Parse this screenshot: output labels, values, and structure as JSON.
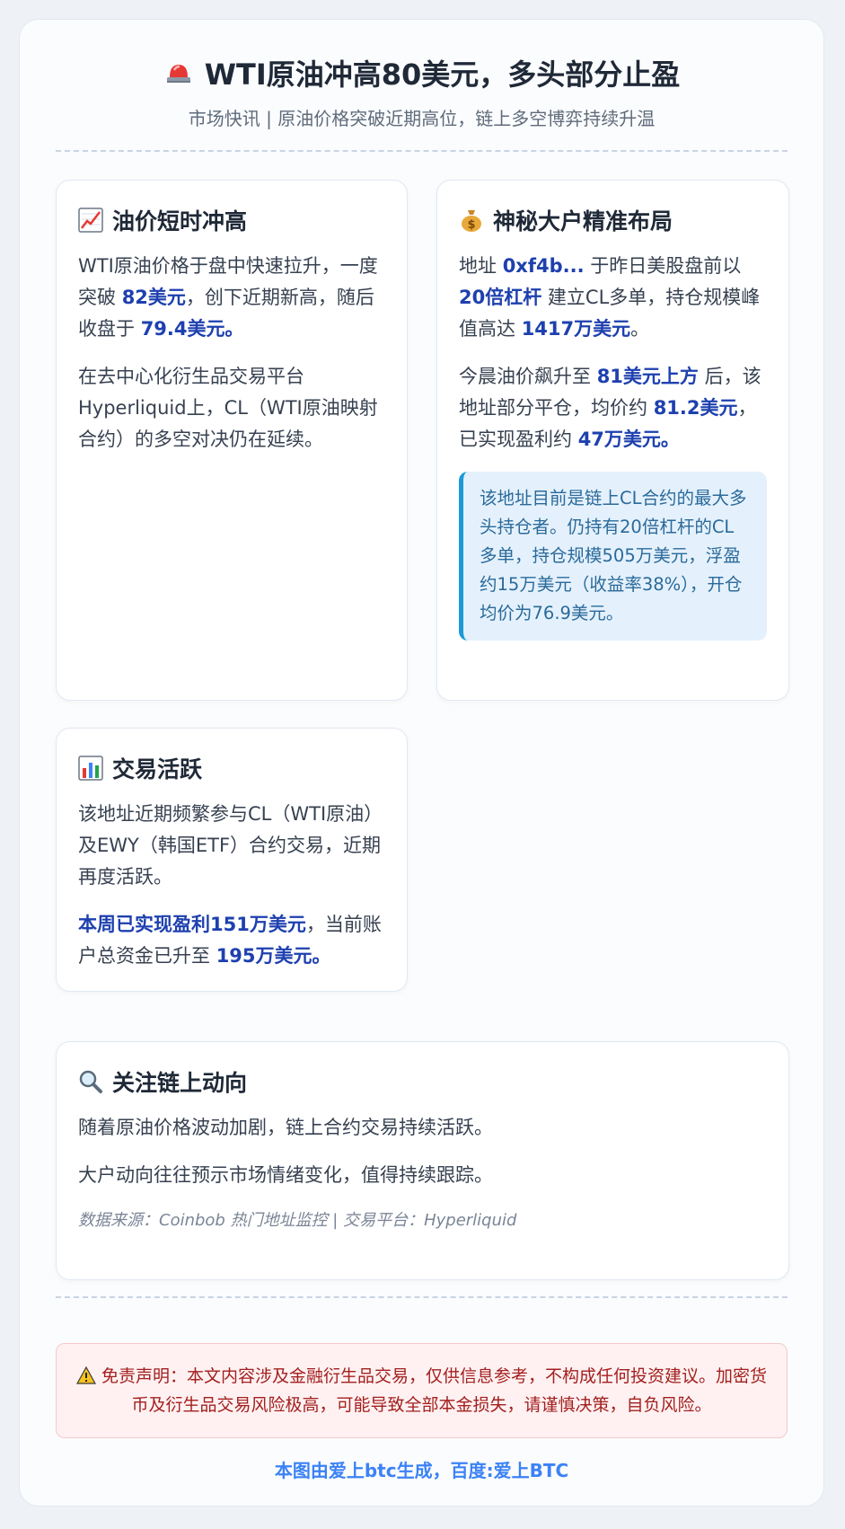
{
  "header": {
    "title": "WTI原油冲高80美元，多头部分止盈",
    "subtitle": "市场快讯 | 原油价格突破近期高位，链上多空博弈持续升温"
  },
  "card1": {
    "icon": "chart-increasing-icon",
    "title": "油价短时冲高",
    "p1_a": "WTI原油价格于盘中快速拉升，一度突破 ",
    "p1_hl1": "82美元",
    "p1_b": "，创下近期新高，随后收盘于 ",
    "p1_hl2": "79.4美元。",
    "p2": "在去中心化衍生品交易平台Hyperliquid上，CL（WTI原油映射合约）的多空对决仍在延续。"
  },
  "card2": {
    "icon": "money-bag-icon",
    "title": "神秘大户精准布局",
    "p1_a": "地址 ",
    "p1_hl1": "0xf4b...",
    "p1_b": " 于昨日美股盘前以 ",
    "p1_hl2": "20倍杠杆",
    "p1_c": " 建立CL多单，持仓规模峰值高达 ",
    "p1_hl3": "1417万美元",
    "p1_d": "。",
    "p2_a": "今晨油价飙升至 ",
    "p2_hl1": "81美元上方",
    "p2_b": " 后，该地址部分平仓，均价约 ",
    "p2_hl2": "81.2美元",
    "p2_c": "，已实现盈利约 ",
    "p2_hl3": "47万美元。",
    "quote": "该地址目前是链上CL合约的最大多头持仓者。仍持有20倍杠杆的CL多单，持仓规模505万美元，浮盈约15万美元（收益率38%），开仓均价为76.9美元。"
  },
  "card3": {
    "icon": "bar-chart-icon",
    "title": "交易活跃",
    "p1": "该地址近期频繁参与CL（WTI原油）及EWY（韩国ETF）合约交易，近期再度活跃。",
    "p2_hl1": "本周已实现盈利151万美元",
    "p2_a": "，当前账户总资金已升至 ",
    "p2_hl2": "195万美元。"
  },
  "card4": {
    "icon": "magnifying-glass-icon",
    "title": "关注链上动向",
    "p1": "随着原油价格波动加剧，链上合约交易持续活跃。",
    "p2": "大户动向往往预示市场情绪变化，值得持续跟踪。",
    "source": "数据来源：Coinbob 热门地址监控 | 交易平台：Hyperliquid"
  },
  "disclaimer": {
    "icon": "warning-icon",
    "text": "免责声明：本文内容涉及金融衍生品交易，仅供信息参考，不构成任何投资建议。加密货币及衍生品交易风险极高，可能导致全部本金损失，请谨慎决策，自负风险。"
  },
  "footer": "本图由爱上btc生成，百度:爱上BTC"
}
